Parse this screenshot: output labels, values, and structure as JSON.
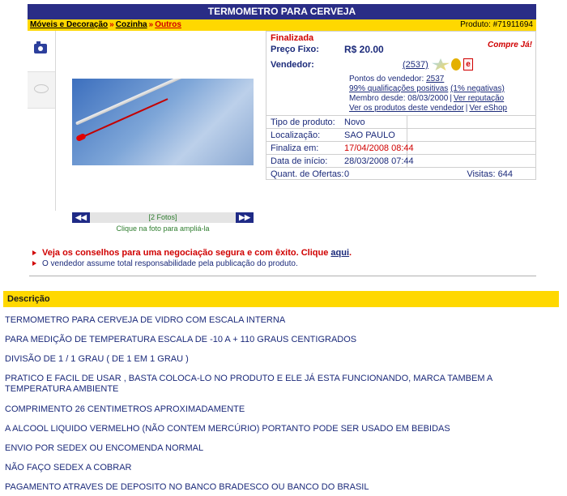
{
  "title": "TERMOMETRO PARA CERVEJA",
  "breadcrumb": {
    "items": [
      "Móveis e Decoração",
      "Cozinha",
      "Outros"
    ],
    "separator": "»",
    "product_number": "Produto: #71911694"
  },
  "gallery": {
    "prev_label": "◀◀",
    "next_label": "▶▶",
    "photo_count": "[2 Fotos]",
    "hint": "Clique na foto para ampliá-la"
  },
  "listing": {
    "status": "Finalizada",
    "price_label": "Preço Fixo:",
    "price": "R$ 20.00",
    "buy_now": "Compre Já!",
    "seller_label": "Vendedor:",
    "seller_score": "(2537)",
    "seller_badge_letter": "e",
    "points_label": "Pontos do vendedor:",
    "points_value": "2537",
    "qualifications": "99% qualificações positivas",
    "negatives": "(1% negativas)",
    "member_since": "Membro desde: 08/03/2000",
    "ver_reputacao": "Ver reputação",
    "ver_produtos": "Ver os produtos deste vendedor",
    "ver_eshop": "Ver eShop",
    "rows": [
      {
        "label": "Tipo de produto:",
        "value": "Novo"
      },
      {
        "label": "Localização:",
        "value": "SAO PAULO"
      },
      {
        "label": "Finaliza em:",
        "value": "17/04/2008 08:44"
      },
      {
        "label": "Data de início:",
        "value": "28/03/2008 07:44"
      },
      {
        "label": "Quant. de Ofertas:",
        "value": "0"
      }
    ],
    "visits": "Visitas: 644"
  },
  "tips": {
    "safe_text": "Veja os conselhos para uma negociação segura e com êxito. Clique",
    "safe_link": "aqui",
    "responsibility": "O vendedor assume total responsabilidade pela publicação do produto."
  },
  "description": {
    "header": "Descrição",
    "paragraphs": [
      "TERMOMETRO PARA CERVEJA DE VIDRO COM ESCALA INTERNA",
      "PARA MEDIÇÃO DE TEMPERATURA  ESCALA  DE  -10  A  + 110 GRAUS CENTIGRADOS",
      "DIVISÃO DE  1 / 1 GRAU ( DE 1 EM 1 GRAU )",
      "PRATICO E FACIL DE USAR , BASTA COLOCA-LO NO PRODUTO E ELE JÁ ESTA FUNCIONANDO, MARCA TAMBEM A TEMPERATURA AMBIENTE",
      "COMPRIMENTO  26 CENTIMETROS  APROXIMADAMENTE",
      "A ALCOOL LIQUIDO VERMELHO (NÃO CONTEM MERCÚRIO) PORTANTO PODE SER USADO EM BEBIDAS",
      "ENVIO POR SEDEX  OU ENCOMENDA NORMAL",
      "NÃO FAÇO SEDEX A COBRAR",
      "PAGAMENTO ATRAVES DE DEPOSITO NO BANCO BRADESCO OU BANCO DO BRASIL"
    ]
  }
}
